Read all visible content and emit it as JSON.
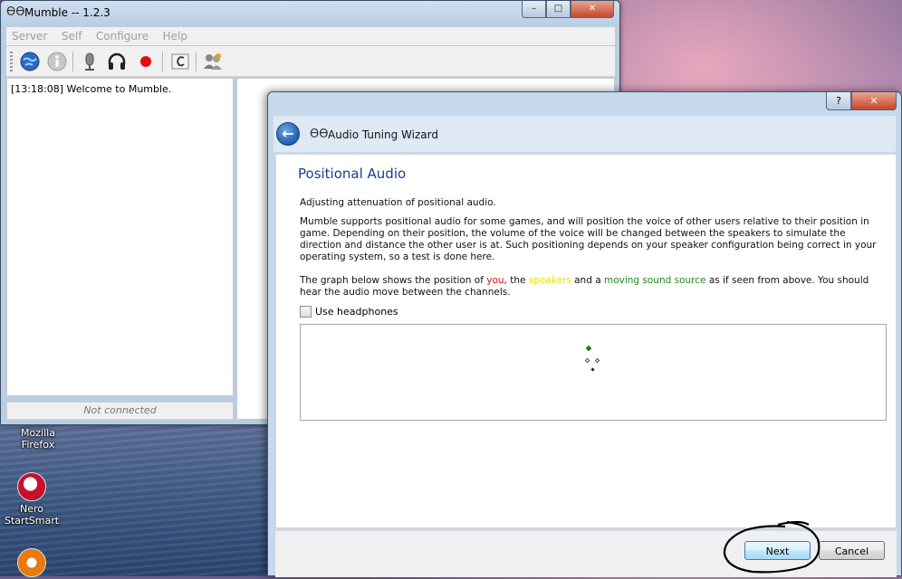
{
  "desktop": {
    "icons": [
      {
        "line1": "Mozilla",
        "line2": "Firefox"
      },
      {
        "line1": "Nero",
        "line2": "StartSmart"
      },
      {
        "line1": "",
        "line2": ""
      }
    ]
  },
  "mumble": {
    "title": "Mumble -- 1.2.3",
    "window_controls": {
      "minimize": "–",
      "maximize": "□",
      "close": "✕"
    },
    "menu": [
      "Server",
      "Self",
      "Configure",
      "Help"
    ],
    "toolbar_icons": [
      "globe-icon",
      "info-icon",
      "microphone-icon",
      "headphones-icon",
      "record-icon",
      "comment-c-icon",
      "users-icon"
    ],
    "log": [
      "[13:18:08] Welcome to Mumble."
    ],
    "status": "Not connected"
  },
  "wizard": {
    "title": "Audio Tuning Wizard",
    "window_controls": {
      "help": "?",
      "close": "✕"
    },
    "back_symbol": "←",
    "heading": "Positional Audio",
    "intro": "Adjusting attenuation of positional audio.",
    "description": "Mumble supports positional audio for some games, and will position the voice of other users relative to their position in game. Depending on their position, the volume of the voice will be changed between the speakers to simulate the direction and distance the other user is at. Such positioning depends on your speaker configuration being correct in your operating system, so a test is done here.",
    "graph_text": {
      "p1": "The graph below shows the position of ",
      "you": "you",
      "p2": ", the ",
      "speakers": "speakers",
      "p3": " and a ",
      "source": "moving sound source",
      "p4": " as if seen from above. You should hear the audio move between the channels."
    },
    "use_headphones_label": "Use headphones",
    "use_headphones_checked": false,
    "buttons": {
      "next": "Next",
      "cancel": "Cancel"
    },
    "colors": {
      "you": "#dd1111",
      "speakers": "#e8e000",
      "source": "#1f8a1f"
    }
  }
}
